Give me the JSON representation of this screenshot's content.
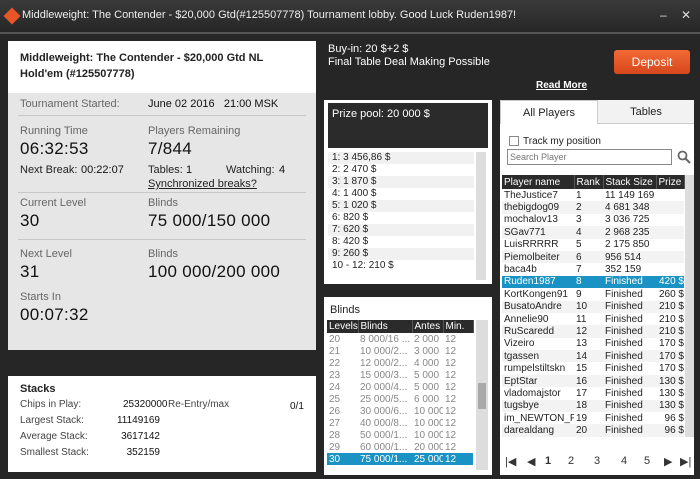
{
  "window": {
    "title": "Middleweight: The Contender - $20,000 Gtd(#125507778) Tournament lobby. Good Luck Ruden1987!",
    "minimize": "–",
    "close": "✕"
  },
  "tournament": {
    "name": "Middleweight: The Contender - $20,000 Gtd NL Hold'em (#125507778)",
    "started_label": "Tournament Started:",
    "started_value": "June 02 2016   21:00 MSK",
    "running_label": "Running Time",
    "running_value": "06:32:53",
    "remaining_label": "Players Remaining",
    "remaining_value": "7/844",
    "next_break_label": "Next Break:",
    "next_break_value": "00:22:07",
    "tables_label": "Tables:",
    "tables_value": "1",
    "watching_label": "Watching:",
    "watching_value": "4",
    "sync_link": "Synchronized breaks?",
    "cur_level_label": "Current Level",
    "cur_level_value": "30",
    "blinds_label": "Blinds",
    "blinds_value": "75 000/150 000",
    "next_level_label": "Next Level",
    "next_level_value": "31",
    "next_blinds_label": "Blinds",
    "next_blinds_value": "100 000/200 000",
    "starts_label": "Starts In",
    "starts_value": "00:07:32"
  },
  "stacks": {
    "title": "Stacks",
    "chips_label": "Chips in Play:",
    "chips_value": "25320000",
    "reentry_label": "Re-Entry/max",
    "reentry_value": "0/1",
    "largest_label": "Largest Stack:",
    "largest_value": "11149169",
    "average_label": "Average Stack:",
    "average_value": "3617142",
    "smallest_label": "Smallest Stack:",
    "smallest_value": "352159"
  },
  "buyin": {
    "line1": "Buy-in: 20 $+2 $",
    "line2": "Final Table Deal Making Possible",
    "read_more": "Read More"
  },
  "deposit_label": "Deposit",
  "prize": {
    "header": "Prize pool: 20 000 $",
    "rows": [
      "1: 3 456,86 $",
      "2: 2 470 $",
      "3: 1 870 $",
      "4: 1 400 $",
      "5: 1 020 $",
      "6: 820 $",
      "7: 620 $",
      "8: 420 $",
      "9: 260 $",
      "10 - 12: 210 $"
    ]
  },
  "blinds": {
    "title": "Blinds",
    "headers": [
      "Levels",
      "Blinds",
      "Antes",
      "Min."
    ],
    "rows": [
      [
        "20",
        "8 000/16 ...",
        "2 000",
        "12"
      ],
      [
        "21",
        "10 000/2...",
        "3 000",
        "12"
      ],
      [
        "22",
        "12 000/2...",
        "4 000",
        "12"
      ],
      [
        "23",
        "15 000/3...",
        "5 000",
        "12"
      ],
      [
        "24",
        "20 000/4...",
        "5 000",
        "12"
      ],
      [
        "25",
        "25 000/5...",
        "6 000",
        "12"
      ],
      [
        "26",
        "30 000/6...",
        "10 000",
        "12"
      ],
      [
        "27",
        "40 000/8...",
        "10 000",
        "12"
      ],
      [
        "28",
        "50 000/1...",
        "10 000",
        "12"
      ],
      [
        "29",
        "60 000/1...",
        "20 000",
        "12"
      ],
      [
        "30",
        "75 000/1...",
        "25 000",
        "12"
      ]
    ]
  },
  "players": {
    "tab_all": "All Players",
    "tab_tables": "Tables",
    "track_label": "Track my position",
    "search_placeholder": "Search Player",
    "headers": [
      "Player name",
      "Rank",
      "Stack Size",
      "Prize"
    ],
    "rows": [
      [
        "TheJustice7",
        "1",
        "11 149 169",
        ""
      ],
      [
        "thebigdog09",
        "2",
        "4 681 348",
        ""
      ],
      [
        "mochalov13",
        "3",
        "3 036 725",
        ""
      ],
      [
        "SGav771",
        "4",
        "2 968 235",
        ""
      ],
      [
        "LuisRRRRR",
        "5",
        "2 175 850",
        ""
      ],
      [
        "Piemolbeiter",
        "6",
        "956 514",
        ""
      ],
      [
        "baca4b",
        "7",
        "352 159",
        ""
      ],
      [
        "Ruden1987",
        "8",
        "Finished",
        "420 $"
      ],
      [
        "KortKongen91",
        "9",
        "Finished",
        "260 $"
      ],
      [
        "BusatoAndre",
        "10",
        "Finished",
        "210 $"
      ],
      [
        "Annelie90",
        "11",
        "Finished",
        "210 $"
      ],
      [
        "RuScaredd",
        "12",
        "Finished",
        "210 $"
      ],
      [
        "Vizeiro",
        "13",
        "Finished",
        "170 $"
      ],
      [
        "tgassen",
        "14",
        "Finished",
        "170 $"
      ],
      [
        "rumpelstiltskn",
        "15",
        "Finished",
        "170 $"
      ],
      [
        "EptStar",
        "16",
        "Finished",
        "130 $"
      ],
      [
        "vladomajstor",
        "17",
        "Finished",
        "130 $"
      ],
      [
        "tugsbye",
        "18",
        "Finished",
        "130 $"
      ],
      [
        "im_NEWTON_FL",
        "19",
        "Finished",
        "96 $"
      ],
      [
        "darealdang",
        "20",
        "Finished",
        "96 $"
      ]
    ],
    "pager": {
      "first": "|◀",
      "prev": "◀",
      "pages": [
        "1",
        "2",
        "3",
        "4",
        "5"
      ],
      "next": "▶",
      "last": "▶|"
    }
  }
}
